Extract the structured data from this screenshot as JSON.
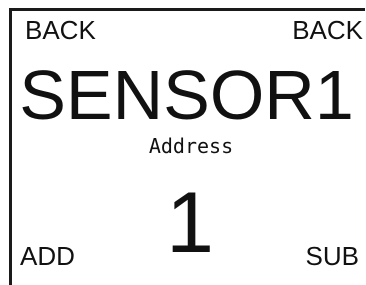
{
  "softkeys": {
    "top_left": "BACK",
    "top_right": "BACK",
    "bottom_left": "ADD",
    "bottom_right": "SUB"
  },
  "display": {
    "sensor_name": "SENSOR1",
    "field_label": "Address",
    "field_value": "1"
  },
  "colors": {
    "text": "#111111",
    "background": "#ffffff",
    "border": "#1a1a1a"
  }
}
